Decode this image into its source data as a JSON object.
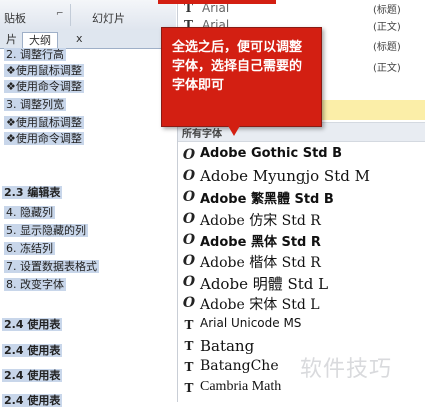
{
  "ribbon": {
    "clipboard_label": "贴板",
    "launcher": "⌐",
    "slides_label": "幻灯片"
  },
  "outline_panel": {
    "tab_slides": "片",
    "tab_outline": "大纲",
    "close": "x",
    "lines": [
      {
        "text": "2. 调整行高",
        "bold": false
      },
      {
        "text": "❖使用鼠标调整",
        "bold": false
      },
      {
        "text": "❖使用命令调整",
        "bold": false
      },
      {
        "text": "3. 调整列宽",
        "bold": false
      },
      {
        "text": "❖使用鼠标调整",
        "bold": false
      },
      {
        "text": "❖使用命令调整",
        "bold": false
      },
      {
        "text": "2.3 编辑表",
        "bold": true
      },
      {
        "text": "4. 隐藏列",
        "bold": false
      },
      {
        "text": "5. 显示隐藏的列",
        "bold": false
      },
      {
        "text": "6. 冻结列",
        "bold": false
      },
      {
        "text": "7. 设置数据表格式",
        "bold": false
      },
      {
        "text": "8. 改变字体",
        "bold": false
      },
      {
        "text": "2.4 使用表",
        "bold": true
      },
      {
        "text": "2.4 使用表",
        "bold": true
      },
      {
        "text": "2.4 使用表",
        "bold": true
      },
      {
        "text": "2.4 使用表",
        "bold": true
      }
    ]
  },
  "font_panel": {
    "theme_fonts": [
      {
        "name": "Arial",
        "role": "(标题)"
      },
      {
        "name": "Arial",
        "role": "(正文)"
      },
      {
        "name": "",
        "role": "(标题)"
      },
      {
        "name": "",
        "role": "(正文)"
      }
    ],
    "section_all_fonts": "所有字体",
    "fonts": [
      {
        "name": "Adobe Gothic Std B",
        "icon": "O",
        "style": "sansb"
      },
      {
        "name": "Adobe Myungjo Std M",
        "icon": "O",
        "style": "serif-lg"
      },
      {
        "name": "Adobe 繁黑體 Std B",
        "icon": "O",
        "style": "sansb"
      },
      {
        "name": "Adobe 仿宋 Std R",
        "icon": "O",
        "style": "serif"
      },
      {
        "name": "Adobe 黑体 Std R",
        "icon": "O",
        "style": "sansb"
      },
      {
        "name": "Adobe 楷体 Std R",
        "icon": "O",
        "style": "serif"
      },
      {
        "name": "Adobe 明體 Std L",
        "icon": "O",
        "style": "serif-lg"
      },
      {
        "name": "Adobe 宋体 Std L",
        "icon": "O",
        "style": "serif"
      },
      {
        "name": "Arial Unicode MS",
        "icon": "T",
        "style": "sans"
      },
      {
        "name": "Batang",
        "icon": "T",
        "style": "serif-lg"
      },
      {
        "name": "BatangChe",
        "icon": "T",
        "style": "serif"
      },
      {
        "name": "Cambria Math",
        "icon": "T",
        "style": "mono"
      }
    ]
  },
  "callout": {
    "text": "全选之后，便可以调整字体，选择自己需要的字体即可",
    "color": "#d31f12"
  },
  "watermark": "软件技巧"
}
